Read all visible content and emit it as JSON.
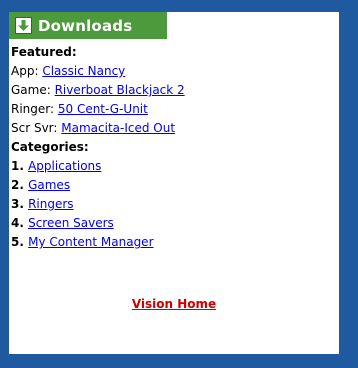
{
  "header": {
    "title": "Downloads",
    "icon": "download-arrow-icon",
    "color": "#4c9a3b"
  },
  "featured": {
    "heading": "Featured:",
    "items": [
      {
        "label": "App:",
        "link": "Classic Nancy"
      },
      {
        "label": "Game:",
        "link": "Riverboat Blackjack 2"
      },
      {
        "label": "Ringer:",
        "link": "50 Cent-G-Unit"
      },
      {
        "label": "Scr Svr:",
        "link": "Mamacita-Iced Out"
      }
    ]
  },
  "categories": {
    "heading": "Categories:",
    "items": [
      {
        "num": "1.",
        "link": "Applications"
      },
      {
        "num": "2.",
        "link": "Games"
      },
      {
        "num": "3.",
        "link": "Ringers"
      },
      {
        "num": "4.",
        "link": "Screen Savers"
      },
      {
        "num": "5.",
        "link": "My Content Manager"
      }
    ]
  },
  "footer": {
    "home_link": "Vision Home"
  },
  "colors": {
    "background": "#1f5aa0",
    "link": "#0000ee",
    "home_link": "#cc0000"
  }
}
